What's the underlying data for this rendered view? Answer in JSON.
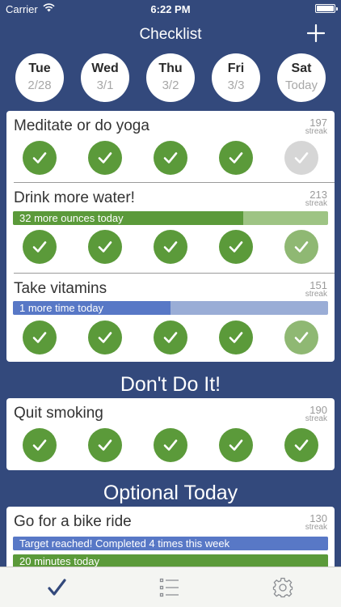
{
  "status": {
    "carrier": "Carrier",
    "time": "6:22 PM"
  },
  "header": {
    "title": "Checklist",
    "add_icon": "plus-icon"
  },
  "days": [
    {
      "name": "Tue",
      "date": "2/28"
    },
    {
      "name": "Wed",
      "date": "3/1"
    },
    {
      "name": "Thu",
      "date": "3/2"
    },
    {
      "name": "Fri",
      "date": "3/3"
    },
    {
      "name": "Sat",
      "date": "Today"
    }
  ],
  "colors": {
    "background": "#33497c",
    "check_green": "#5b9a3a",
    "check_light_green": "#8fb873",
    "check_gray": "#d6d6d6",
    "progress_green": "#5b9a3a",
    "progress_green_track": "#9ec484",
    "progress_blue": "#5878c6",
    "progress_blue_track": "#9aadd6"
  },
  "habits": [
    {
      "title": "Meditate or do yoga",
      "streak": "197",
      "streak_label": "streak",
      "checks": [
        "done",
        "done",
        "done",
        "done",
        "empty"
      ]
    },
    {
      "title": "Drink more water!",
      "streak": "213",
      "streak_label": "streak",
      "progress": {
        "text": "32 more ounces today",
        "fraction": 0.73,
        "color": "green"
      },
      "checks": [
        "done",
        "done",
        "done",
        "done",
        "partial"
      ]
    },
    {
      "title": "Take vitamins",
      "streak": "151",
      "streak_label": "streak",
      "progress": {
        "text": "1 more time today",
        "fraction": 0.5,
        "color": "blue"
      },
      "checks": [
        "done",
        "done",
        "done",
        "done",
        "partial"
      ]
    }
  ],
  "dont_section": {
    "title": "Don't Do It!",
    "habits": [
      {
        "title": "Quit smoking",
        "streak": "190",
        "streak_label": "streak",
        "checks": [
          "done",
          "done",
          "done",
          "done",
          "done"
        ]
      }
    ]
  },
  "optional_section": {
    "title": "Optional Today",
    "habits": [
      {
        "title": "Go for a bike ride",
        "streak": "130",
        "streak_label": "streak",
        "progress": [
          {
            "text": "Target reached! Completed 4 times this week",
            "fraction": 1.0,
            "color": "blue"
          },
          {
            "text": "20 minutes today",
            "fraction": 1.0,
            "color": "green"
          }
        ]
      }
    ]
  },
  "tabs": [
    {
      "icon": "checkmark-icon",
      "active": true
    },
    {
      "icon": "list-icon",
      "active": false
    },
    {
      "icon": "gear-icon",
      "active": false
    }
  ]
}
